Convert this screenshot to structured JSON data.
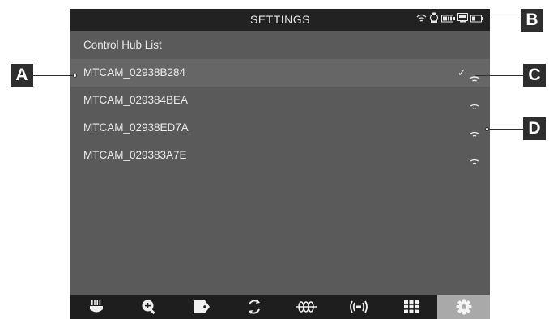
{
  "status_bar": {
    "title": "SETTINGS",
    "icons": [
      "wifi-icon",
      "camera-icon",
      "battery-icon",
      "monitor-icon",
      "battery-icon"
    ]
  },
  "list": {
    "header": "Control Hub List",
    "items": [
      {
        "name": "MTCAM_02938B284",
        "selected": true,
        "connected": true
      },
      {
        "name": "MTCAM_029384BEA",
        "selected": false,
        "connected": false
      },
      {
        "name": "MTCAM_02938ED7A",
        "selected": false,
        "connected": false
      },
      {
        "name": "MTCAM_029383A7E",
        "selected": false,
        "connected": false
      }
    ],
    "check_glyph": "✓"
  },
  "tab_bar": {
    "tabs": [
      {
        "icon": "lens-icon",
        "active": false
      },
      {
        "icon": "zoom-in-icon",
        "active": false
      },
      {
        "icon": "tag-icon",
        "active": false
      },
      {
        "icon": "refresh-icon",
        "active": false
      },
      {
        "icon": "motor-icon",
        "active": false
      },
      {
        "icon": "wireless-icon",
        "active": false
      },
      {
        "icon": "grid-icon",
        "active": false
      },
      {
        "icon": "gear-icon",
        "active": true
      }
    ]
  },
  "callouts": {
    "a": "A",
    "b": "B",
    "c": "C",
    "d": "D"
  },
  "colors": {
    "screen_bg": "#5a5a5a",
    "bar_bg": "#222222",
    "selected_row": "#666666",
    "active_tab": "#a9a9a9",
    "callout_bg": "#2e2e2e"
  }
}
